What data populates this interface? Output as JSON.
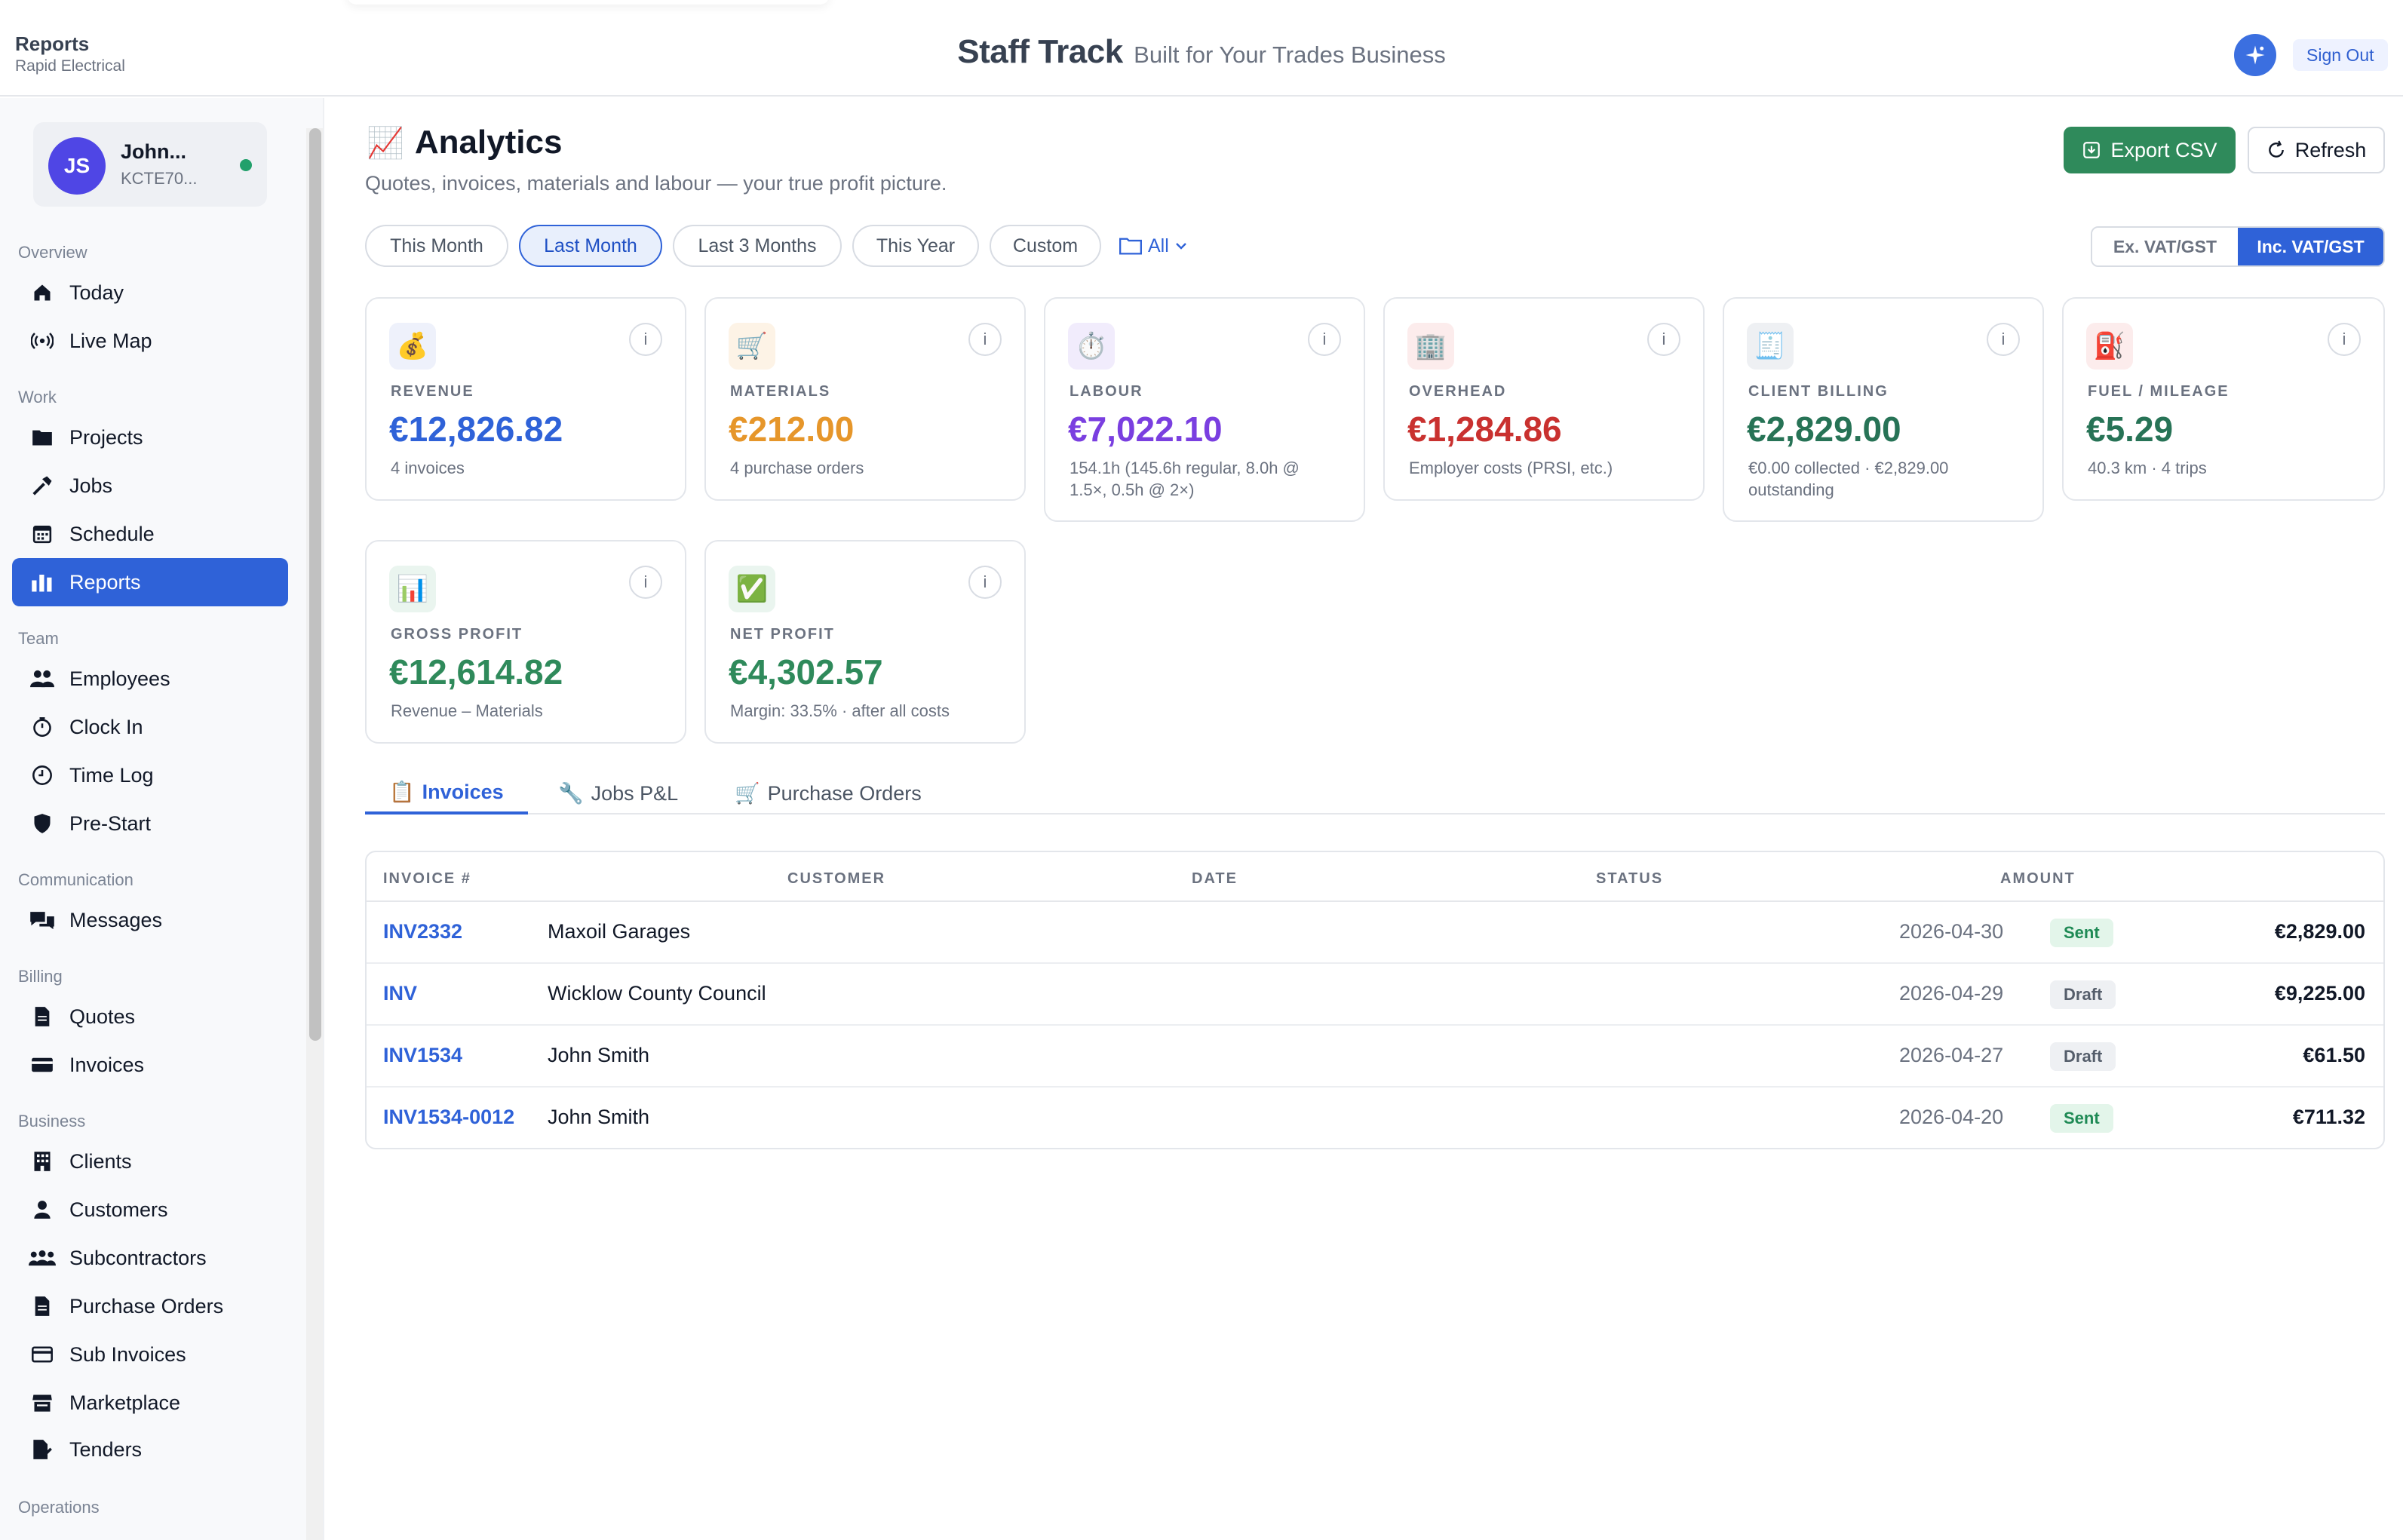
{
  "header": {
    "page_name": "Reports",
    "company": "Rapid Electrical",
    "brand": "Staff Track",
    "tagline": "Built for Your Trades Business",
    "sign_out_label": "Sign Out"
  },
  "user": {
    "initials": "JS",
    "name": "John...",
    "id": "KCTE70..."
  },
  "sidebar": {
    "sections": {
      "overview": "Overview",
      "work": "Work",
      "team": "Team",
      "communication": "Communication",
      "billing": "Billing",
      "business": "Business",
      "operations": "Operations"
    },
    "items": [
      {
        "label": "Today",
        "icon": "home-icon"
      },
      {
        "label": "Live Map",
        "icon": "broadcast-icon"
      },
      {
        "label": "Projects",
        "icon": "folder-icon"
      },
      {
        "label": "Jobs",
        "icon": "hammer-icon"
      },
      {
        "label": "Schedule",
        "icon": "calendar-icon"
      },
      {
        "label": "Reports",
        "icon": "bar-chart-icon"
      },
      {
        "label": "Employees",
        "icon": "people-icon"
      },
      {
        "label": "Clock In",
        "icon": "stopwatch-icon"
      },
      {
        "label": "Time Log",
        "icon": "clock-icon"
      },
      {
        "label": "Pre-Start",
        "icon": "shield-icon"
      },
      {
        "label": "Messages",
        "icon": "chat-icon"
      },
      {
        "label": "Quotes",
        "icon": "document-icon"
      },
      {
        "label": "Invoices",
        "icon": "card-icon"
      },
      {
        "label": "Clients",
        "icon": "building-icon"
      },
      {
        "label": "Customers",
        "icon": "person-icon"
      },
      {
        "label": "Subcontractors",
        "icon": "group-icon"
      },
      {
        "label": "Purchase Orders",
        "icon": "file-icon"
      },
      {
        "label": "Sub Invoices",
        "icon": "card-outline-icon"
      },
      {
        "label": "Marketplace",
        "icon": "store-icon"
      },
      {
        "label": "Tenders",
        "icon": "file-signature-icon"
      }
    ]
  },
  "analytics": {
    "title": "Analytics",
    "subtitle": "Quotes, invoices, materials and labour — your true profit picture.",
    "export_label": "Export CSV",
    "refresh_label": "Refresh",
    "periods": [
      "This Month",
      "Last Month",
      "Last 3 Months",
      "This Year",
      "Custom"
    ],
    "selected_period": "Last Month",
    "folder_filter": "All",
    "vat_options": [
      "Ex. VAT/GST",
      "Inc. VAT/GST"
    ],
    "selected_vat": "Inc. VAT/GST"
  },
  "stats": [
    {
      "label": "REVENUE",
      "value": "€12,826.82",
      "note": "4 invoices",
      "color": "#2f62d8",
      "icon": "money-bag-icon"
    },
    {
      "label": "MATERIALS",
      "value": "€212.00",
      "note": "4 purchase orders",
      "color": "#e6962a",
      "icon": "cart-icon"
    },
    {
      "label": "LABOUR",
      "value": "€7,022.10",
      "note": "154.1h (145.6h regular, 8.0h @ 1.5×, 0.5h @ 2×)",
      "color": "#7a3fe0",
      "icon": "stopwatch-icon"
    },
    {
      "label": "OVERHEAD",
      "value": "€1,284.86",
      "note": "Employer costs (PRSI, etc.)",
      "color": "#c9312f",
      "icon": "office-building-icon"
    },
    {
      "label": "CLIENT BILLING",
      "value": "€2,829.00",
      "note": "€0.00 collected · €2,829.00 outstanding",
      "color": "#277356",
      "icon": "receipt-icon"
    },
    {
      "label": "FUEL / MILEAGE",
      "value": "€5.29",
      "note": "40.3 km · 4 trips",
      "color": "#277356",
      "icon": "fuel-pump-icon"
    },
    {
      "label": "GROSS PROFIT",
      "value": "€12,614.82",
      "note": "Revenue – Materials",
      "color": "#2f8a5b",
      "icon": "bar-chart-icon"
    },
    {
      "label": "NET PROFIT",
      "value": "€4,302.57",
      "note": "Margin: 33.5% · after all costs",
      "color": "#2f8a5b",
      "icon": "check-mark-icon"
    }
  ],
  "tabs": [
    {
      "label": "Invoices",
      "icon": "clipboard-icon"
    },
    {
      "label": "Jobs P&L",
      "icon": "wrench-icon"
    },
    {
      "label": "Purchase Orders",
      "icon": "cart-icon"
    }
  ],
  "table": {
    "columns": [
      "INVOICE #",
      "CUSTOMER",
      "DATE",
      "STATUS",
      "AMOUNT"
    ],
    "rows": [
      {
        "invoice": "INV2332",
        "customer": "Maxoil Garages",
        "date": "2026-04-30",
        "status": "Sent",
        "amount": "€2,829.00"
      },
      {
        "invoice": "INV",
        "customer": "Wicklow County Council",
        "date": "2026-04-29",
        "status": "Draft",
        "amount": "€9,225.00"
      },
      {
        "invoice": "INV1534",
        "customer": "John Smith",
        "date": "2026-04-27",
        "status": "Draft",
        "amount": "€61.50"
      },
      {
        "invoice": "INV1534-0012",
        "customer": "John Smith",
        "date": "2026-04-20",
        "status": "Sent",
        "amount": "€711.32"
      }
    ]
  }
}
